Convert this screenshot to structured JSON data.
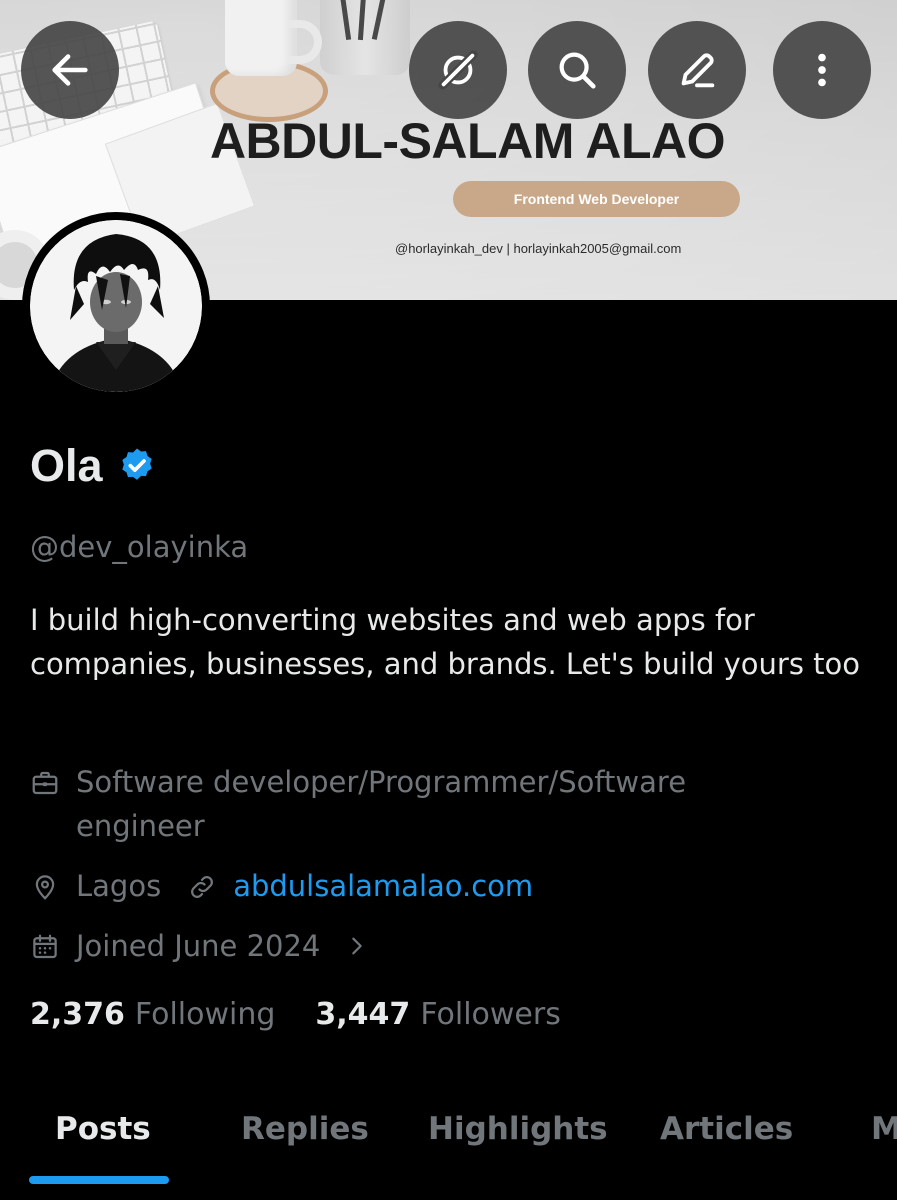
{
  "banner": {
    "title": "ABDUL-SALAM ALAO",
    "pill": "Frontend Web Developer",
    "contact": "@horlayinkah_dev |  horlayinkah2005@gmail.com"
  },
  "top_actions": {
    "icons": [
      "back-arrow-icon",
      "grok-icon",
      "search-icon",
      "edit-icon",
      "more-vertical-icon"
    ]
  },
  "profile": {
    "name": "Ola",
    "verified": true,
    "handle": "@dev_olayinka",
    "bio": "I build high-converting websites and web apps for companies, businesses, and brands. Let's build yours too",
    "category": "Software developer/Programmer/Software engineer",
    "location": "Lagos",
    "website": "abdulsalamalao.com",
    "joined": "Joined June 2024",
    "following_count": "2,376",
    "following_label": "Following",
    "followers_count": "3,447",
    "followers_label": "Followers"
  },
  "tabs": [
    {
      "label": "Posts",
      "active": true
    },
    {
      "label": "Replies",
      "active": false
    },
    {
      "label": "Highlights",
      "active": false
    },
    {
      "label": "Articles",
      "active": false
    },
    {
      "label": "M",
      "active": false
    }
  ],
  "colors": {
    "background": "#000000",
    "text_primary": "#e7e9ea",
    "text_secondary": "#71767b",
    "accent": "#1d9bf0",
    "banner_pill": "#c9a88a"
  }
}
